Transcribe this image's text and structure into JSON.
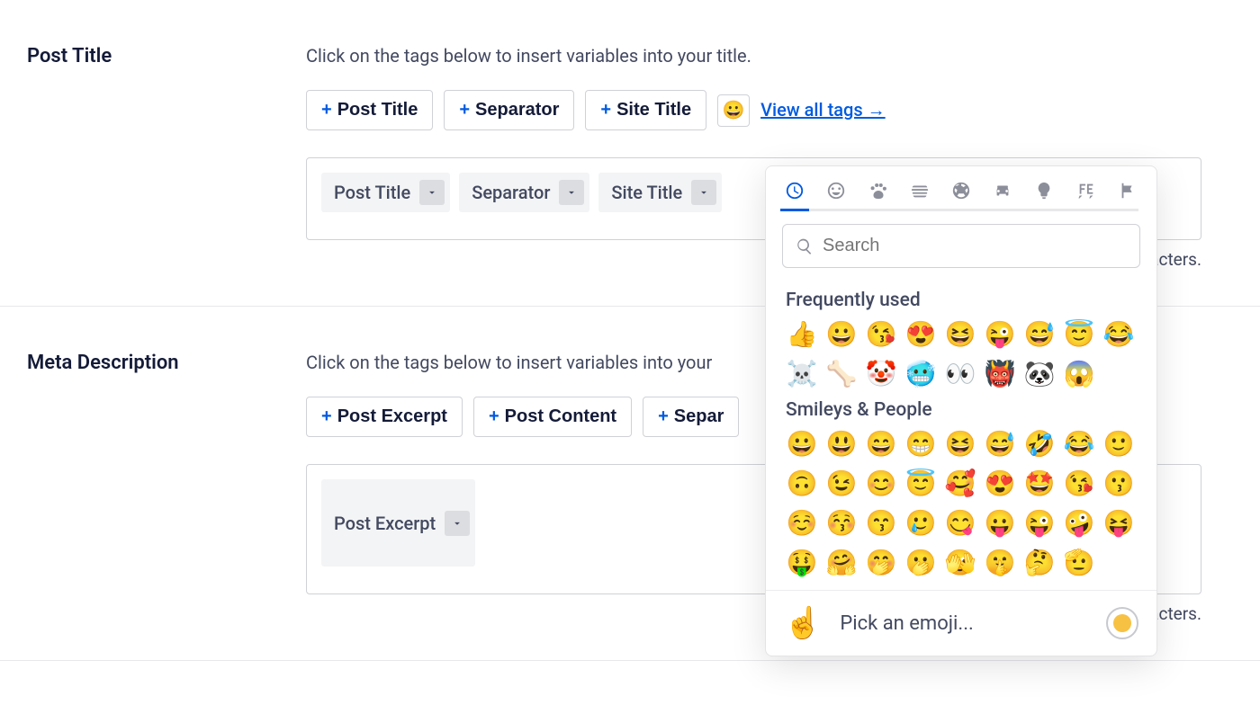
{
  "postTitle": {
    "label": "Post Title",
    "helper": "Click on the tags below to insert variables into your title.",
    "tagButtons": [
      "Post Title",
      "Separator",
      "Site Title"
    ],
    "emojiTrigger": "😀",
    "viewAll": "View all tags →",
    "chips": [
      "Post Title",
      "Separator",
      "Site Title"
    ],
    "hintSuffix": "aracters."
  },
  "metaDescription": {
    "label": "Meta Description",
    "helper": "Click on the tags below to insert variables into your",
    "tagButtons": [
      "Post Excerpt",
      "Post Content",
      "Separ"
    ],
    "chips": [
      "Post Excerpt"
    ],
    "hintSuffix": "aracters."
  },
  "emojiPicker": {
    "searchPlaceholder": "Search",
    "categories": {
      "frequentlyUsed": {
        "label": "Frequently used",
        "emojis": [
          "👍",
          "😀",
          "😘",
          "😍",
          "😆",
          "😜",
          "😅",
          "😇",
          "😂",
          "☠️",
          "🦴",
          "🤡",
          "🥶",
          "👀",
          "👹",
          "🐼",
          "😱"
        ]
      },
      "smileysPeople": {
        "label": "Smileys & People",
        "emojis": [
          "😀",
          "😃",
          "😄",
          "😁",
          "😆",
          "😅",
          "🤣",
          "😂",
          "🙂",
          "🙃",
          "😉",
          "😊",
          "😇",
          "🥰",
          "😍",
          "🤩",
          "😘",
          "😗",
          "☺️",
          "😚",
          "😙",
          "🥲",
          "😋",
          "😛",
          "😜",
          "🤪",
          "😝",
          "🤑",
          "🤗",
          "🤭",
          "🫢",
          "🫣",
          "🤫",
          "🤔",
          "🫡"
        ]
      }
    },
    "footer": {
      "hand": "☝️",
      "text": "Pick an emoji..."
    }
  }
}
